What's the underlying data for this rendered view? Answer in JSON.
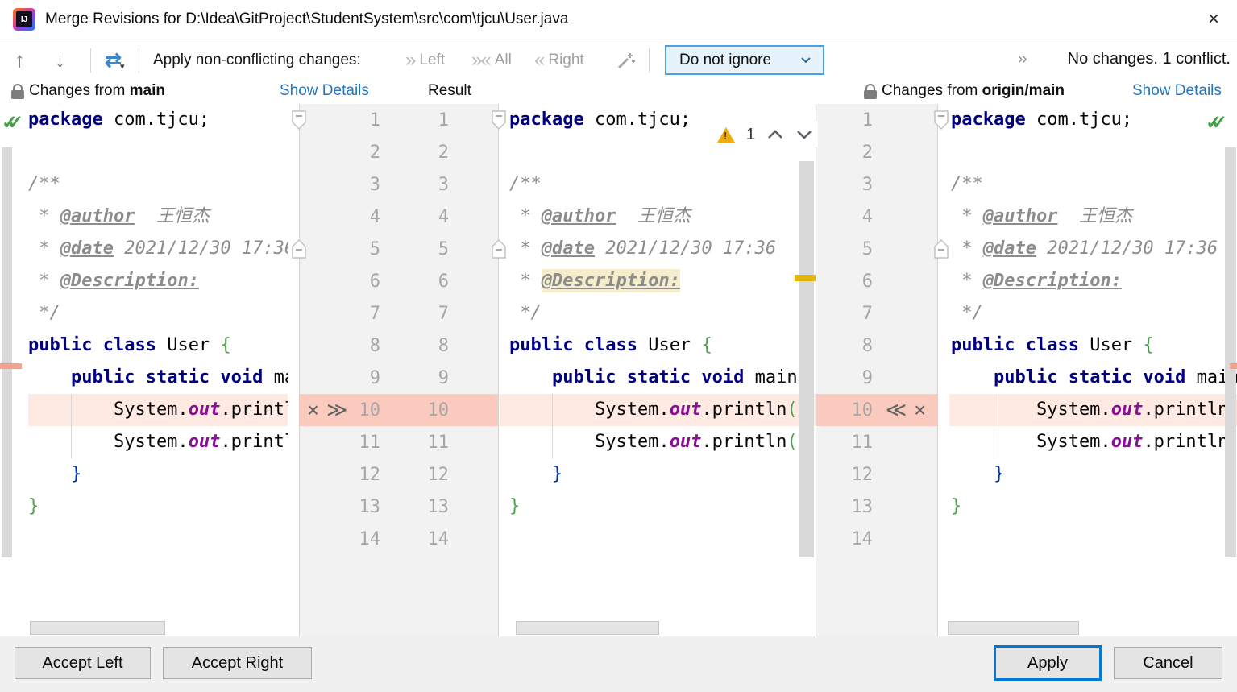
{
  "window": {
    "title": "Merge Revisions for D:\\Idea\\GitProject\\StudentSystem\\src\\com\\tjcu\\User.java",
    "app_icon": "IJ",
    "close_glyph": "×"
  },
  "toolbar": {
    "prev_glyph": "↑",
    "next_glyph": "↓",
    "apply_all_glyph": "⇄",
    "apply_all_caret": "▾",
    "apply_label": "Apply non-conflicting changes:",
    "apply_left_glyph": "»",
    "apply_left_label": "Left",
    "apply_all_sides_glyph": "»«",
    "apply_all_label": "All",
    "apply_right_glyph": "«",
    "apply_right_label": "Right",
    "ignore_value": "Do not ignore",
    "expander_glyph": "››",
    "status": "No changes. 1 conflict."
  },
  "headers": {
    "left_label": "Changes from",
    "left_branch": "main",
    "left_link": "Show Details",
    "result_label": "Result",
    "right_label": "Changes from",
    "right_branch": "origin/main",
    "right_link": "Show Details"
  },
  "merge": {
    "conflict_line": 10,
    "desc_highlight_line": 6,
    "warning_count": "1",
    "gutter_icons_left": [
      "×",
      "≫"
    ],
    "gutter_icons_right": [
      "≪",
      "×"
    ],
    "lines": [
      {
        "n": 1,
        "t": [
          [
            "kw",
            "package"
          ],
          [
            "pl",
            " com.tjcu;"
          ]
        ]
      },
      {
        "n": 2,
        "t": []
      },
      {
        "n": 3,
        "t": [
          [
            "cmt",
            "/**"
          ]
        ]
      },
      {
        "n": 4,
        "t": [
          [
            "cmt",
            " * "
          ],
          [
            "tag",
            "@author"
          ],
          [
            "cmt",
            "  王恒杰"
          ]
        ]
      },
      {
        "n": 5,
        "t": [
          [
            "cmt",
            " * "
          ],
          [
            "tag",
            "@date"
          ],
          [
            "cmt",
            " 2021/12/30 17:36"
          ]
        ]
      },
      {
        "n": 6,
        "t": [
          [
            "cmt",
            " * "
          ],
          [
            "tag",
            "@Description:"
          ]
        ]
      },
      {
        "n": 7,
        "t": [
          [
            "cmt",
            " */"
          ]
        ]
      },
      {
        "n": 8,
        "t": [
          [
            "kw",
            "public class"
          ],
          [
            "pl",
            " User "
          ],
          [
            "bg",
            "{"
          ]
        ]
      },
      {
        "n": 9,
        "t": [
          [
            "pl",
            "    "
          ],
          [
            "kw",
            "public static void"
          ],
          [
            "pl",
            " main"
          ]
        ]
      },
      {
        "n": 10,
        "t": [
          [
            "pl",
            "        System."
          ],
          [
            "fld",
            "out"
          ],
          [
            "pl",
            ".println"
          ],
          [
            "pg",
            "("
          ]
        ]
      },
      {
        "n": 11,
        "t": [
          [
            "pl",
            "        System."
          ],
          [
            "fld",
            "out"
          ],
          [
            "pl",
            ".println"
          ],
          [
            "pg",
            "("
          ]
        ]
      },
      {
        "n": 12,
        "t": [
          [
            "pl",
            "    "
          ],
          [
            "bb",
            "}"
          ]
        ]
      },
      {
        "n": 13,
        "t": [
          [
            "bg",
            "}"
          ]
        ]
      },
      {
        "n": 14,
        "t": []
      }
    ]
  },
  "buttons": {
    "accept_left": "Accept Left",
    "accept_right": "Accept Right",
    "apply": "Apply",
    "cancel": "Cancel"
  },
  "colors": {
    "accent": "#0078d7",
    "link": "#2575bf",
    "conflict-gutter": "#fbcabe",
    "conflict-line": "#ffe9e3",
    "desc-hl": "#f6edcd",
    "warning": "#efad0a",
    "keyword": "#000080",
    "field": "#871094",
    "comment": "#8c8c8c",
    "brace-green": "#4da24d",
    "brace-blue": "#0033b3",
    "gutter-bg": "#f2f2f2"
  }
}
